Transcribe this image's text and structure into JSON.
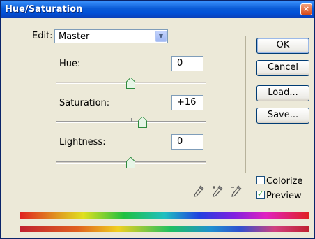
{
  "window": {
    "title": "Hue/Saturation",
    "close_glyph": "×"
  },
  "edit": {
    "label": "Edit:",
    "value": "Master"
  },
  "sliders": [
    {
      "label": "Hue:",
      "value": "0",
      "level_fraction": 0.5
    },
    {
      "label": "Saturation:",
      "value": "+16",
      "level_fraction": 0.58
    },
    {
      "label": "Lightness:",
      "value": "0",
      "level_fraction": 0.5
    }
  ],
  "buttons": {
    "ok": "OK",
    "cancel": "Cancel",
    "load": "Load...",
    "save": "Save..."
  },
  "options": {
    "colorize": {
      "label": "Colorize",
      "checked": false
    },
    "preview": {
      "label": "Preview",
      "checked": true
    }
  },
  "icons": [
    "eyedropper-icon",
    "eyedropper-plus-icon",
    "eyedropper-minus-icon"
  ],
  "colors": {
    "title_bar": "#0a5bd6",
    "dialog_bg": "#ece9d8",
    "check_green": "#21a121"
  }
}
